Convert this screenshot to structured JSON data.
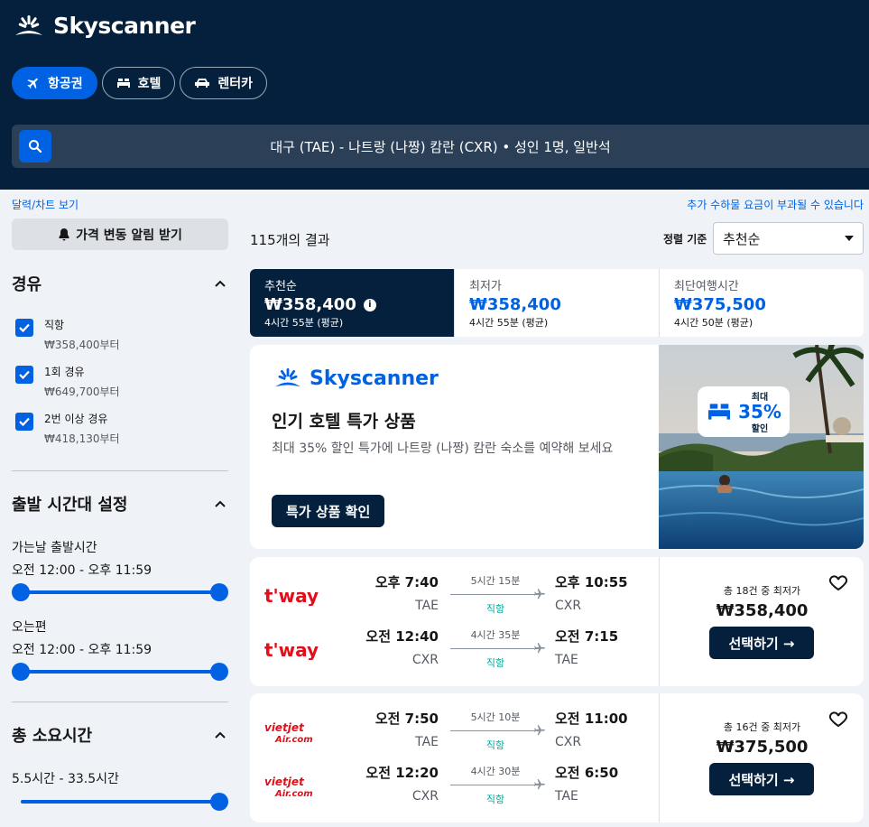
{
  "header": {
    "logo_text": "Skyscanner",
    "nav": [
      {
        "label": "항공권",
        "icon": "airplane-icon",
        "active": true
      },
      {
        "label": "호텔",
        "icon": "bed-icon",
        "active": false
      },
      {
        "label": "렌터카",
        "icon": "car-icon",
        "active": false
      }
    ],
    "search_summary": "대구 (TAE) - 나트랑 (나짱) 캄란 (CXR)  •  성인 1명, 일반석"
  },
  "links": {
    "calendar": "달력/차트 보기",
    "fees": "추가 수하물 요금이 부과될 수 있습니다"
  },
  "sidebar": {
    "alert_button": "가격 변동 알림 받기",
    "stops": {
      "title": "경유",
      "options": [
        {
          "label": "직항",
          "price": "₩358,400부터",
          "checked": true
        },
        {
          "label": "1회 경유",
          "price": "₩649,700부터",
          "checked": true
        },
        {
          "label": "2번 이상 경유",
          "price": "₩418,130부터",
          "checked": true
        }
      ]
    },
    "departure_times": {
      "title": "출발 시간대 설정",
      "outbound_label": "가는날 출발시간",
      "outbound_range": "오전 12:00 - 오후 11:59",
      "return_label": "오는편",
      "return_range": "오전 12:00 - 오후 11:59"
    },
    "duration": {
      "title": "총 소요시간",
      "range": "5.5시간 - 33.5시간"
    }
  },
  "results": {
    "count": "115개의 결과",
    "sort_label": "정렬 기준",
    "sort_value": "추천순"
  },
  "tabs": [
    {
      "name": "추천순",
      "price": "₩358,400",
      "duration": "4시간 55분 (평균)",
      "active": true
    },
    {
      "name": "최저가",
      "price": "₩358,400",
      "duration": "4시간 55분 (평균)",
      "active": false
    },
    {
      "name": "최단여행시간",
      "price": "₩375,500",
      "duration": "4시간 50분 (평균)",
      "active": false
    }
  ],
  "ad": {
    "logo_text": "Skyscanner",
    "title": "인기 호텔 특가 상품",
    "desc": "최대 35% 할인 특가에 나트랑 (나짱) 캄란 숙소를 예약해 보세요",
    "button": "특가 상품 확인",
    "badge_small_top": "최대",
    "badge_big": "35%",
    "badge_small_bottom": "할인"
  },
  "flights": [
    {
      "airline": "t'way",
      "legs": [
        {
          "dep_time": "오후 7:40",
          "dep_code": "TAE",
          "duration": "5시간 15분",
          "stops": "직항",
          "arr_time": "오후 10:55",
          "arr_code": "CXR"
        },
        {
          "dep_time": "오전 12:40",
          "dep_code": "CXR",
          "duration": "4시간 35분",
          "stops": "직항",
          "arr_time": "오전 7:15",
          "arr_code": "TAE"
        }
      ],
      "price_note": "총 18건 중 최저가",
      "price": "₩358,400",
      "select": "선택하기 →"
    },
    {
      "airline": "vietjet Air.com",
      "legs": [
        {
          "dep_time": "오전 7:50",
          "dep_code": "TAE",
          "duration": "5시간 10분",
          "stops": "직항",
          "arr_time": "오전 11:00",
          "arr_code": "CXR"
        },
        {
          "dep_time": "오전 12:20",
          "dep_code": "CXR",
          "duration": "4시간 30분",
          "stops": "직항",
          "arr_time": "오전 6:50",
          "arr_code": "TAE"
        }
      ],
      "price_note": "총 16건 중 최저가",
      "price": "₩375,500",
      "select": "선택하기 →"
    }
  ],
  "colors": {
    "header_bg": "#05203c",
    "accent": "#0062e3",
    "direct": "#00a698",
    "page_bg": "#eff3f8"
  }
}
